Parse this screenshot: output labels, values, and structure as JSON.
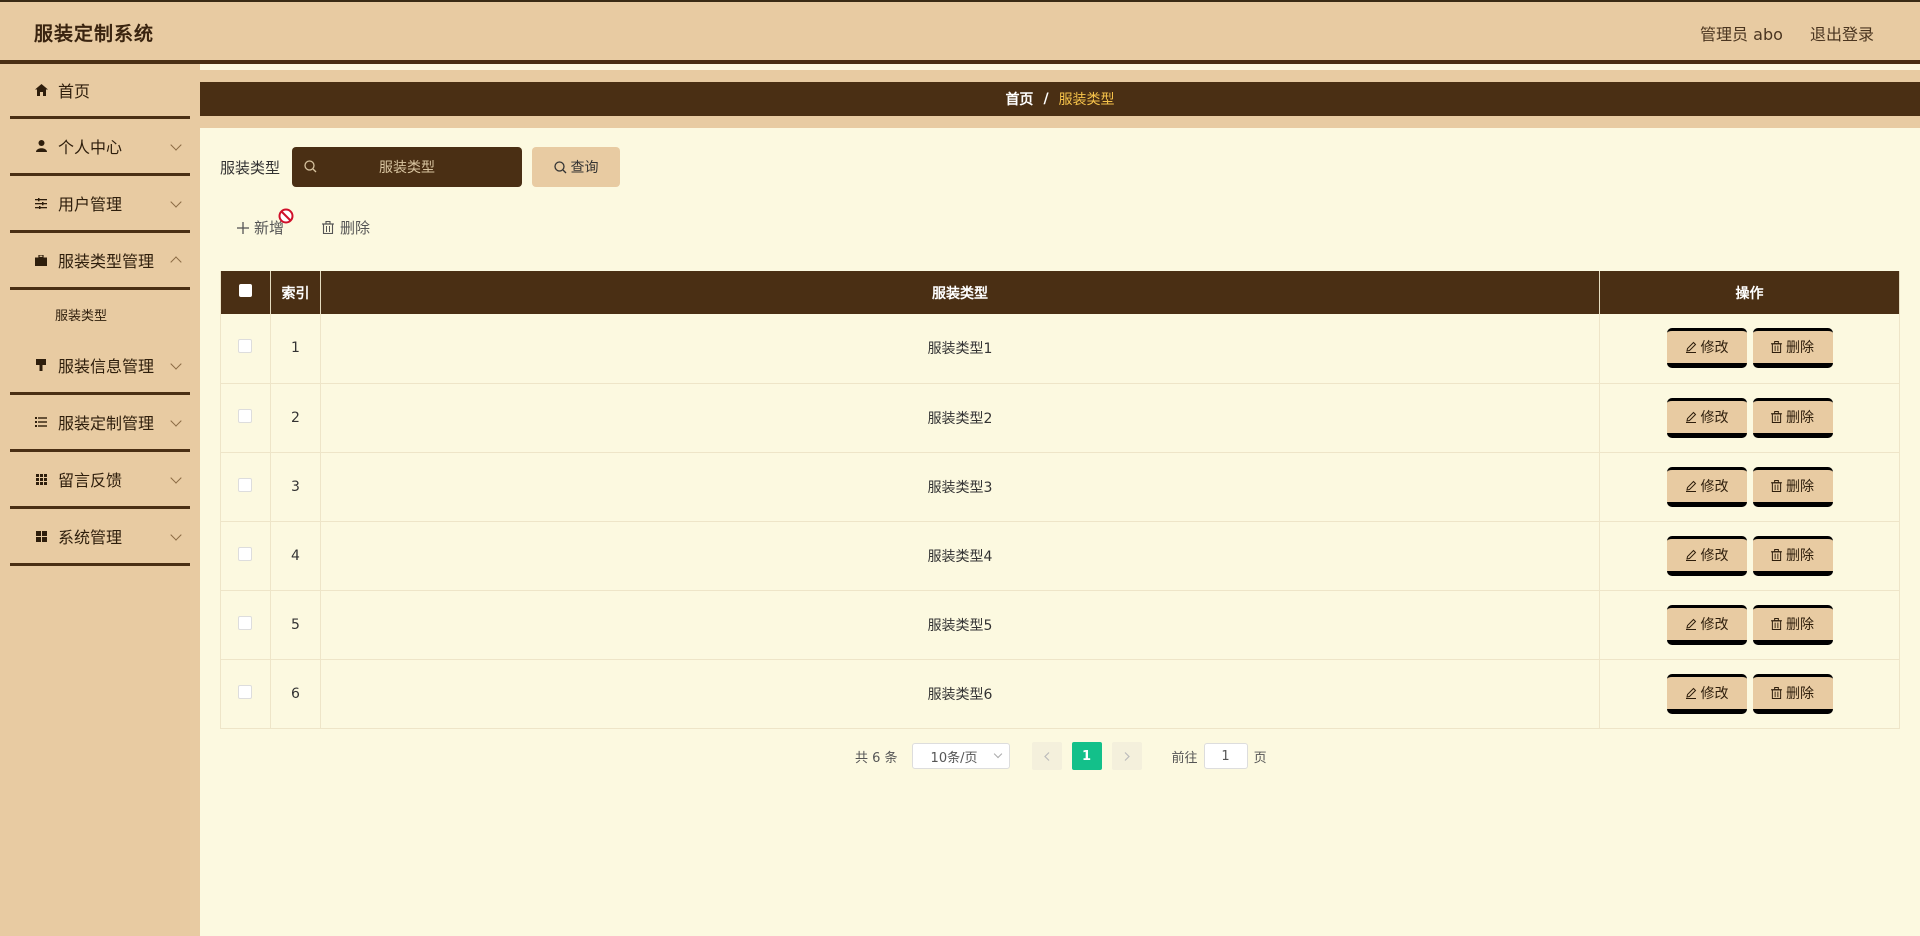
{
  "app": {
    "title": "服装定制系统"
  },
  "header": {
    "user_label": "管理员 abo",
    "logout_label": "退出登录"
  },
  "sidebar": {
    "items": [
      {
        "label": "首页",
        "icon": "home-icon"
      },
      {
        "label": "个人中心",
        "icon": "user-icon"
      },
      {
        "label": "用户管理",
        "icon": "sliders-icon"
      },
      {
        "label": "服装类型管理",
        "icon": "briefcase-icon"
      },
      {
        "label": "服装信息管理",
        "icon": "brush-icon"
      },
      {
        "label": "服装定制管理",
        "icon": "list-icon"
      },
      {
        "label": "留言反馈",
        "icon": "grid-icon"
      },
      {
        "label": "系统管理",
        "icon": "apps-icon"
      }
    ],
    "submenu": {
      "label": "服装类型"
    }
  },
  "breadcrumb": {
    "home": "首页",
    "separator": "/",
    "current": "服装类型"
  },
  "search": {
    "label": "服装类型",
    "placeholder": "服装类型",
    "button_label": "查询"
  },
  "actions": {
    "add_label": "新增",
    "delete_label": "删除"
  },
  "table": {
    "headers": {
      "index": "索引",
      "type": "服装类型",
      "ops": "操作"
    },
    "rows": [
      {
        "index": "1",
        "type": "服装类型1"
      },
      {
        "index": "2",
        "type": "服装类型2"
      },
      {
        "index": "3",
        "type": "服装类型3"
      },
      {
        "index": "4",
        "type": "服装类型4"
      },
      {
        "index": "5",
        "type": "服装类型5"
      },
      {
        "index": "6",
        "type": "服装类型6"
      }
    ],
    "edit_label": "修改",
    "delete_label": "删除"
  },
  "pagination": {
    "total": "共 6 条",
    "page_size": "10条/页",
    "current_page": "1",
    "goto_label": "前往",
    "goto_value": "1",
    "page_suffix": "页"
  },
  "colors": {
    "accent": "#4a2f14",
    "sidebar_bg": "#e8cba2",
    "content_bg": "#fcf9e0",
    "active_page": "#13c08a",
    "crumb_current": "#f5c24a"
  }
}
